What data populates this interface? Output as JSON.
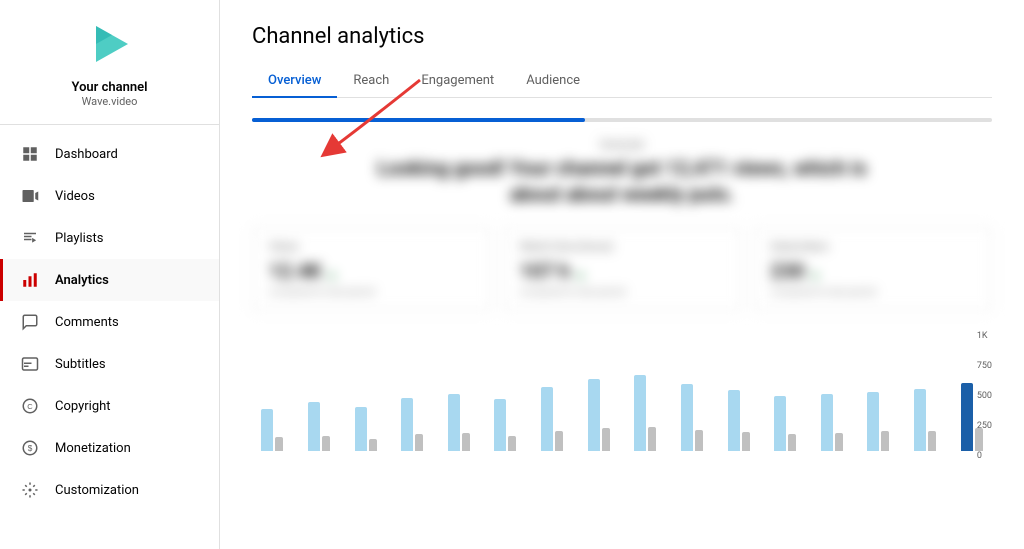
{
  "sidebar": {
    "channel": {
      "name": "Your channel",
      "handle": "Wave.video"
    },
    "nav_items": [
      {
        "id": "dashboard",
        "label": "Dashboard",
        "icon": "dashboard",
        "active": false
      },
      {
        "id": "videos",
        "label": "Videos",
        "icon": "video",
        "active": false
      },
      {
        "id": "playlists",
        "label": "Playlists",
        "icon": "playlists",
        "active": false
      },
      {
        "id": "analytics",
        "label": "Analytics",
        "icon": "analytics",
        "active": true
      },
      {
        "id": "comments",
        "label": "Comments",
        "icon": "comments",
        "active": false
      },
      {
        "id": "subtitles",
        "label": "Subtitles",
        "icon": "subtitles",
        "active": false
      },
      {
        "id": "copyright",
        "label": "Copyright",
        "icon": "copyright",
        "active": false
      },
      {
        "id": "monetization",
        "label": "Monetization",
        "icon": "monetization",
        "active": false
      },
      {
        "id": "customization",
        "label": "Customization",
        "icon": "customization",
        "active": false
      }
    ]
  },
  "main": {
    "page_title": "Channel analytics",
    "tabs": [
      {
        "id": "overview",
        "label": "Overview",
        "active": true
      },
      {
        "id": "reach",
        "label": "Reach",
        "active": false
      },
      {
        "id": "engagement",
        "label": "Engagement",
        "active": false
      },
      {
        "id": "audience",
        "label": "Audience",
        "active": false
      }
    ],
    "progress_bar_pct": 45,
    "stats": [
      {
        "label": "Views",
        "value": "12.4K",
        "change": "↑ 12%",
        "footer": "compared to last period"
      },
      {
        "label": "Watch time (hours)",
        "value": "107 h",
        "change": "↑ 8%",
        "footer": "compared to last period"
      },
      {
        "label": "Subscribers",
        "value": "230",
        "change": "↑ 5%",
        "footer": "compared to last period"
      }
    ],
    "chart": {
      "y_labels": [
        "1K",
        "750",
        "500",
        "250",
        "0"
      ],
      "bars": [
        {
          "blue": 55,
          "gray": 18,
          "highlight": false
        },
        {
          "blue": 65,
          "gray": 20,
          "highlight": false
        },
        {
          "blue": 58,
          "gray": 16,
          "highlight": false
        },
        {
          "blue": 70,
          "gray": 22,
          "highlight": false
        },
        {
          "blue": 75,
          "gray": 24,
          "highlight": false
        },
        {
          "blue": 68,
          "gray": 20,
          "highlight": false
        },
        {
          "blue": 85,
          "gray": 26,
          "highlight": false
        },
        {
          "blue": 95,
          "gray": 30,
          "highlight": false
        },
        {
          "blue": 100,
          "gray": 32,
          "highlight": false
        },
        {
          "blue": 88,
          "gray": 28,
          "highlight": false
        },
        {
          "blue": 80,
          "gray": 25,
          "highlight": false
        },
        {
          "blue": 72,
          "gray": 22,
          "highlight": false
        },
        {
          "blue": 75,
          "gray": 24,
          "highlight": false
        },
        {
          "blue": 78,
          "gray": 26,
          "highlight": false
        },
        {
          "blue": 82,
          "gray": 27,
          "highlight": false
        },
        {
          "blue": 90,
          "gray": 30,
          "highlight": true
        }
      ]
    }
  },
  "colors": {
    "accent_red": "#cc0000",
    "accent_blue": "#065fd4",
    "bar_light_blue": "#a8d8f0",
    "bar_dark_blue": "#1b5fa8",
    "bar_gray": "#c0c0c0"
  }
}
